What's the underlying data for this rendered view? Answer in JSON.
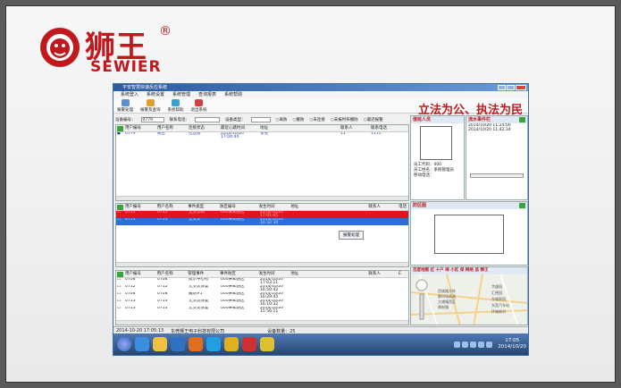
{
  "brand": {
    "cn": "狮王",
    "en": "SEWIER",
    "reg": "®"
  },
  "window": {
    "title": "平安智慧快速反应系统",
    "menu": [
      "系统登入",
      "系统设置",
      "系统管理",
      "查询报表",
      "系统帮助"
    ],
    "toolbar": [
      "报警处理",
      "报警及查询",
      "系统帮助",
      "退出系统"
    ],
    "slogan": "立法为公、执法为民"
  },
  "filters": {
    "account_label": "设备编号：",
    "account_value": "0779",
    "phone_label": "联系电话：",
    "type_label": "设备类型：",
    "radios": [
      "离防",
      "撤防",
      "未连接",
      "未报时布撤防",
      "最近报警"
    ]
  },
  "devices": {
    "headers": [
      "用户编号",
      "用户名称",
      "连接状态",
      "最近心跳时间",
      "地址",
      "联系人",
      "联系电话"
    ],
    "rows": [
      {
        "id": "0779",
        "name": "狮王",
        "status": "已连接",
        "time": "2014/10/20 17:04:44",
        "addr": "东莞",
        "contact": "11",
        "phone": "1111"
      }
    ]
  },
  "alarms": {
    "headers": [
      "用户编号",
      "用户名称",
      "事件类型",
      "防区编号",
      "发生时间",
      "地址",
      "联系人",
      "电话"
    ],
    "rows": [
      {
        "id": "0711",
        "name": "0711",
        "type": "无交流断",
        "zone": "000未知防区",
        "time": "2014/10/20 17:01:45"
      },
      {
        "id": "0713",
        "name": "0713",
        "type": "无交流",
        "zone": "000未知防区",
        "time": "2014/10/20 16:32:30"
      }
    ],
    "popup": "报警处理"
  },
  "events": {
    "headers": [
      "用户编号",
      "用户名称",
      "管理事件",
      "事件防区",
      "发生时间",
      "地址",
      "联系人",
      "E"
    ],
    "rows": [
      {
        "id": "0708",
        "name": "0708",
        "type": "提示中心检",
        "zone": "000未知防区",
        "time": "2014/10/20 17:03:11"
      },
      {
        "id": "0712",
        "name": "0712",
        "type": "无交流恢复",
        "zone": "000未知防区",
        "time": "2014/10/20 16:50:42"
      },
      {
        "id": "0708",
        "name": "0708",
        "type": "撤防#1",
        "zone": "000未知防区",
        "time": "2014/10/20 16:29:45"
      },
      {
        "id": "0713",
        "name": "0713",
        "type": "无交流恢复",
        "zone": "000未知防区",
        "time": "2014/10/20 16:10:32"
      },
      {
        "id": "0713",
        "name": "0713",
        "type": "无交流恢复",
        "zone": "000未知防区",
        "time": "2014/10/20 15:56:11"
      }
    ]
  },
  "side": {
    "staff_title": "值班人员",
    "log_title": "流水事件栏",
    "log": [
      "2014/10/20 11:24:00",
      "2014/10/20 11:42:34"
    ],
    "staff_code": "员工代码：000",
    "staff_name": "员工姓名：系统管理员",
    "staff_tel": "移动电话：",
    "zone_title": "防区图",
    "map_title": "百度地图  红 十户 绿 小区 保 网络 监 狮王",
    "map_labels": [
      "西城镇大岭",
      "都市场高速",
      "大埔镇西区",
      "厚街镇",
      "华盛园",
      "汇德园",
      "东城家园",
      "东莞汽车站",
      "环城新村"
    ]
  },
  "status": {
    "datetime": "2014-10-20 17:05:13",
    "company": "东莞狮王电子科技有限公司",
    "count": "设备数量：25"
  },
  "taskbar": {
    "clock_time": "17:05",
    "clock_date": "2014/10/20"
  }
}
